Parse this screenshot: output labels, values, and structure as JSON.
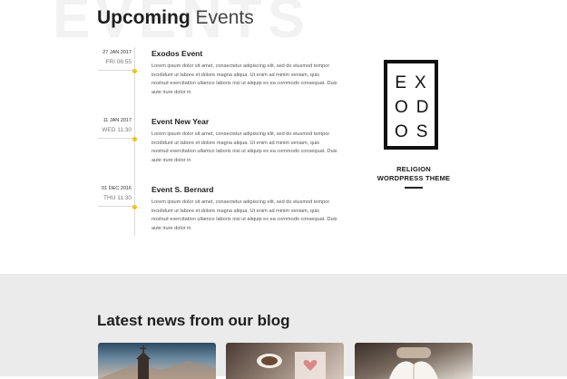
{
  "events": {
    "background_word": "EVENTS",
    "title_bold": "Upcoming",
    "title_light": "Events",
    "items": [
      {
        "date": "27 JAN 2017",
        "time": "FRI 06:55",
        "title": "Exodos Event",
        "description": "Lorem ipsum dolor sit amet, consectetur adipiscing elit, sed do eiusmod tempor incididunt ut labore et dolore magna aliqua. Ut enim ad minim veniam, quis nostrud exercitation ullamco laboris nisi ut aliquip ex ea commodo consequat. Duis aute irure dolor in"
      },
      {
        "date": "11 JAN 2017",
        "time": "WED 11:30",
        "title": "Event New Year",
        "description": "Lorem ipsum dolor sit amet, consectetur adipiscing elit, sed do eiusmod tempor incididunt ut labore et dolore magna aliqua. Ut enim ad minim veniam, quis nostrud exercitation ullamco laboris nisi ut aliquip ex ea commodo consequat. Duis aute irure dolor in"
      },
      {
        "date": "01 DEC 2016",
        "time": "THU 11:30",
        "title": "Event S. Bernard",
        "description": "Lorem ipsum dolor sit amet, consectetur adipiscing elit, sed do eiusmod tempor incididunt ut labore et dolore magna aliqua. Ut enim ad minim veniam, quis nostrud exercitation ullamco laboris nisi ut aliquip ex ea commodo consequat. Duis aute irure dolor in"
      }
    ]
  },
  "logo": {
    "row1": "EX",
    "row2": "OD",
    "row3": "OS",
    "subtitle_line1": "RELIGION",
    "subtitle_line2": "WORDPRESS THEME"
  },
  "blog": {
    "title": "Latest news from our blog",
    "cards": [
      {
        "image_icon": "church-photo"
      },
      {
        "image_icon": "coffee-heart-photo"
      },
      {
        "image_icon": "open-book-photo"
      }
    ]
  },
  "colors": {
    "accent": "#f0c419",
    "blog_background": "#ebebeb",
    "text_dark": "#1e1e1e"
  }
}
